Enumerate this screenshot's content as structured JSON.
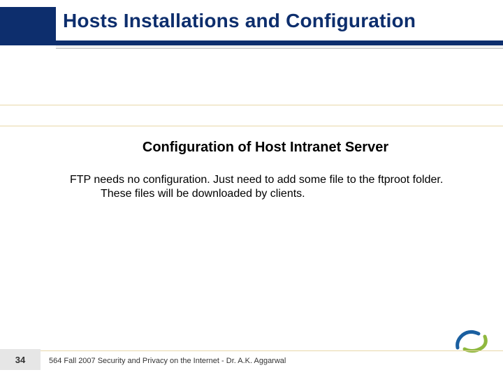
{
  "header": {
    "title": "Hosts Installations and Configuration"
  },
  "content": {
    "subtitle": "Configuration of Host Intranet Server",
    "body": "FTP needs no configuration. Just need to add some file to the ftproot folder. These files will be downloaded by clients."
  },
  "footer": {
    "page_number": "34",
    "text": "564 Fall 2007 Security and Privacy on the Internet - Dr. A.K. Aggarwal"
  }
}
